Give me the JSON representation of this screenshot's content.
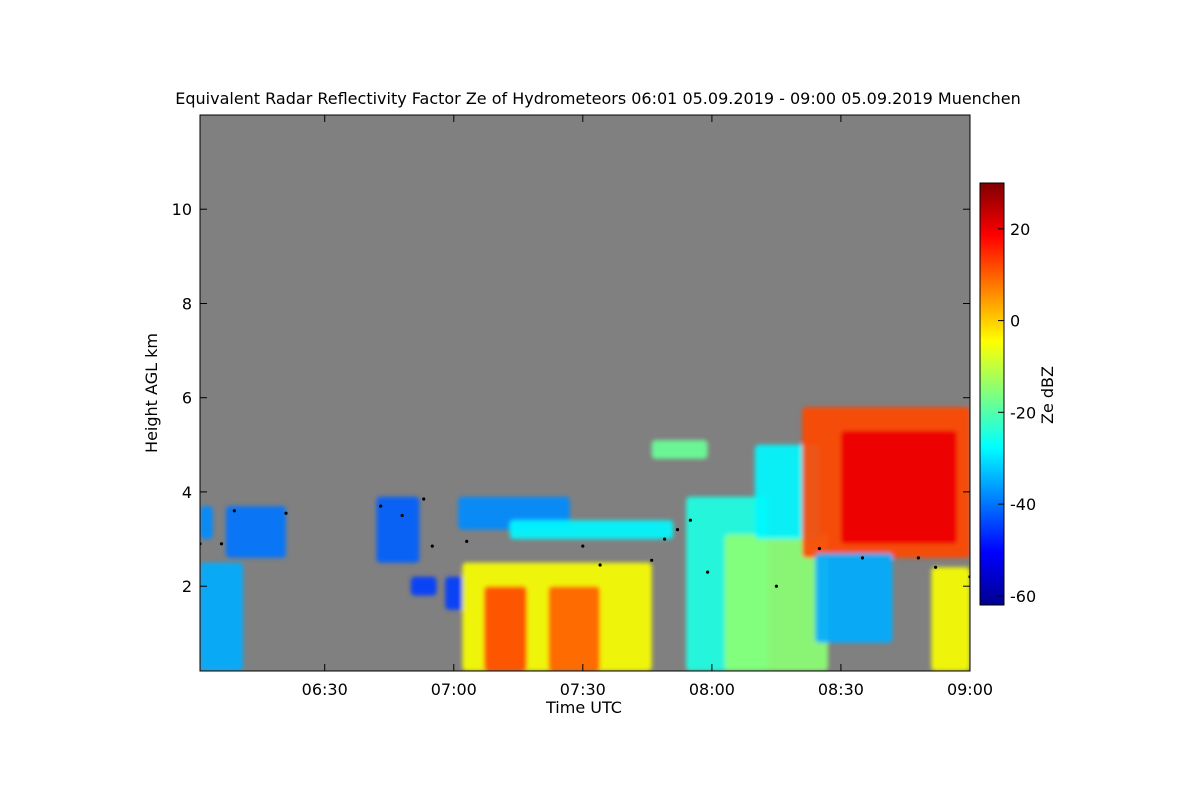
{
  "chart_data": {
    "type": "heatmap",
    "title": "Equivalent Radar Reflectivity Factor Ze of Hydrometeors   06:01 05.09.2019 - 09:00 05.09.2019 Muenchen",
    "xlabel": "Time UTC",
    "ylabel": "Height AGL km",
    "xlim": [
      "06:01",
      "09:00"
    ],
    "ylim": [
      0.2,
      12.0
    ],
    "x_ticks": [
      "06:30",
      "07:00",
      "07:30",
      "08:00",
      "08:30",
      "09:00"
    ],
    "y_ticks": [
      2,
      4,
      6,
      8,
      10
    ],
    "background_color": "#808080",
    "colorbar": {
      "label": "Ze dBZ",
      "range": [
        -62,
        30
      ],
      "ticks": [
        20,
        0,
        -20,
        -40,
        -60
      ],
      "colormap": "jet"
    },
    "echoes": [
      {
        "t0": "06:01",
        "t1": "06:11",
        "h0": 0.2,
        "h1": 2.5,
        "ze": -35
      },
      {
        "t0": "06:01",
        "t1": "06:04",
        "h0": 3.0,
        "h1": 3.7,
        "ze": -38
      },
      {
        "t0": "06:07",
        "t1": "06:21",
        "h0": 2.6,
        "h1": 3.7,
        "ze": -40
      },
      {
        "t0": "06:42",
        "t1": "06:52",
        "h0": 2.5,
        "h1": 3.9,
        "ze": -42
      },
      {
        "t0": "06:50",
        "t1": "06:56",
        "h0": 1.8,
        "h1": 2.2,
        "ze": -45
      },
      {
        "t0": "06:58",
        "t1": "07:03",
        "h0": 1.5,
        "h1": 2.2,
        "ze": -45
      },
      {
        "t0": "07:01",
        "t1": "07:27",
        "h0": 3.2,
        "h1": 3.9,
        "ze": -38
      },
      {
        "t0": "07:13",
        "t1": "07:51",
        "h0": 3.0,
        "h1": 3.4,
        "ze": -28
      },
      {
        "t0": "07:02",
        "t1": "07:46",
        "h0": 0.2,
        "h1": 2.5,
        "ze": -5
      },
      {
        "t0": "07:07",
        "t1": "07:17",
        "h0": 0.2,
        "h1": 2.0,
        "ze": 12
      },
      {
        "t0": "07:22",
        "t1": "07:34",
        "h0": 0.2,
        "h1": 2.0,
        "ze": 10
      },
      {
        "t0": "07:46",
        "t1": "07:59",
        "h0": 4.7,
        "h1": 5.1,
        "ze": -18
      },
      {
        "t0": "07:54",
        "t1": "08:13",
        "h0": 0.2,
        "h1": 3.9,
        "ze": -25
      },
      {
        "t0": "08:03",
        "t1": "08:27",
        "h0": 0.2,
        "h1": 3.1,
        "ze": -15
      },
      {
        "t0": "08:10",
        "t1": "08:25",
        "h0": 3.0,
        "h1": 5.0,
        "ze": -28
      },
      {
        "t0": "08:21",
        "t1": "09:00",
        "h0": 2.6,
        "h1": 5.8,
        "ze": 12
      },
      {
        "t0": "08:30",
        "t1": "08:57",
        "h0": 2.9,
        "h1": 5.3,
        "ze": 20
      },
      {
        "t0": "08:24",
        "t1": "08:42",
        "h0": 0.8,
        "h1": 2.7,
        "ze": -35
      },
      {
        "t0": "08:51",
        "t1": "09:00",
        "h0": 0.2,
        "h1": 2.4,
        "ze": -5
      }
    ],
    "cloud_base_series": [
      {
        "t": "06:01",
        "h": 2.9
      },
      {
        "t": "06:06",
        "h": 2.9
      },
      {
        "t": "06:09",
        "h": 3.6
      },
      {
        "t": "06:21",
        "h": 3.55
      },
      {
        "t": "06:43",
        "h": 3.7
      },
      {
        "t": "06:48",
        "h": 3.5
      },
      {
        "t": "06:53",
        "h": 3.85
      },
      {
        "t": "06:55",
        "h": 2.85
      },
      {
        "t": "07:03",
        "h": 2.95
      },
      {
        "t": "07:30",
        "h": 2.85
      },
      {
        "t": "07:34",
        "h": 2.45
      },
      {
        "t": "07:46",
        "h": 2.55
      },
      {
        "t": "07:49",
        "h": 3.0
      },
      {
        "t": "07:52",
        "h": 3.2
      },
      {
        "t": "07:55",
        "h": 3.4
      },
      {
        "t": "07:59",
        "h": 2.3
      },
      {
        "t": "08:15",
        "h": 2.0
      },
      {
        "t": "08:25",
        "h": 2.8
      },
      {
        "t": "08:35",
        "h": 2.6
      },
      {
        "t": "08:48",
        "h": 2.6
      },
      {
        "t": "08:52",
        "h": 2.4
      },
      {
        "t": "09:00",
        "h": 2.2
      }
    ]
  }
}
